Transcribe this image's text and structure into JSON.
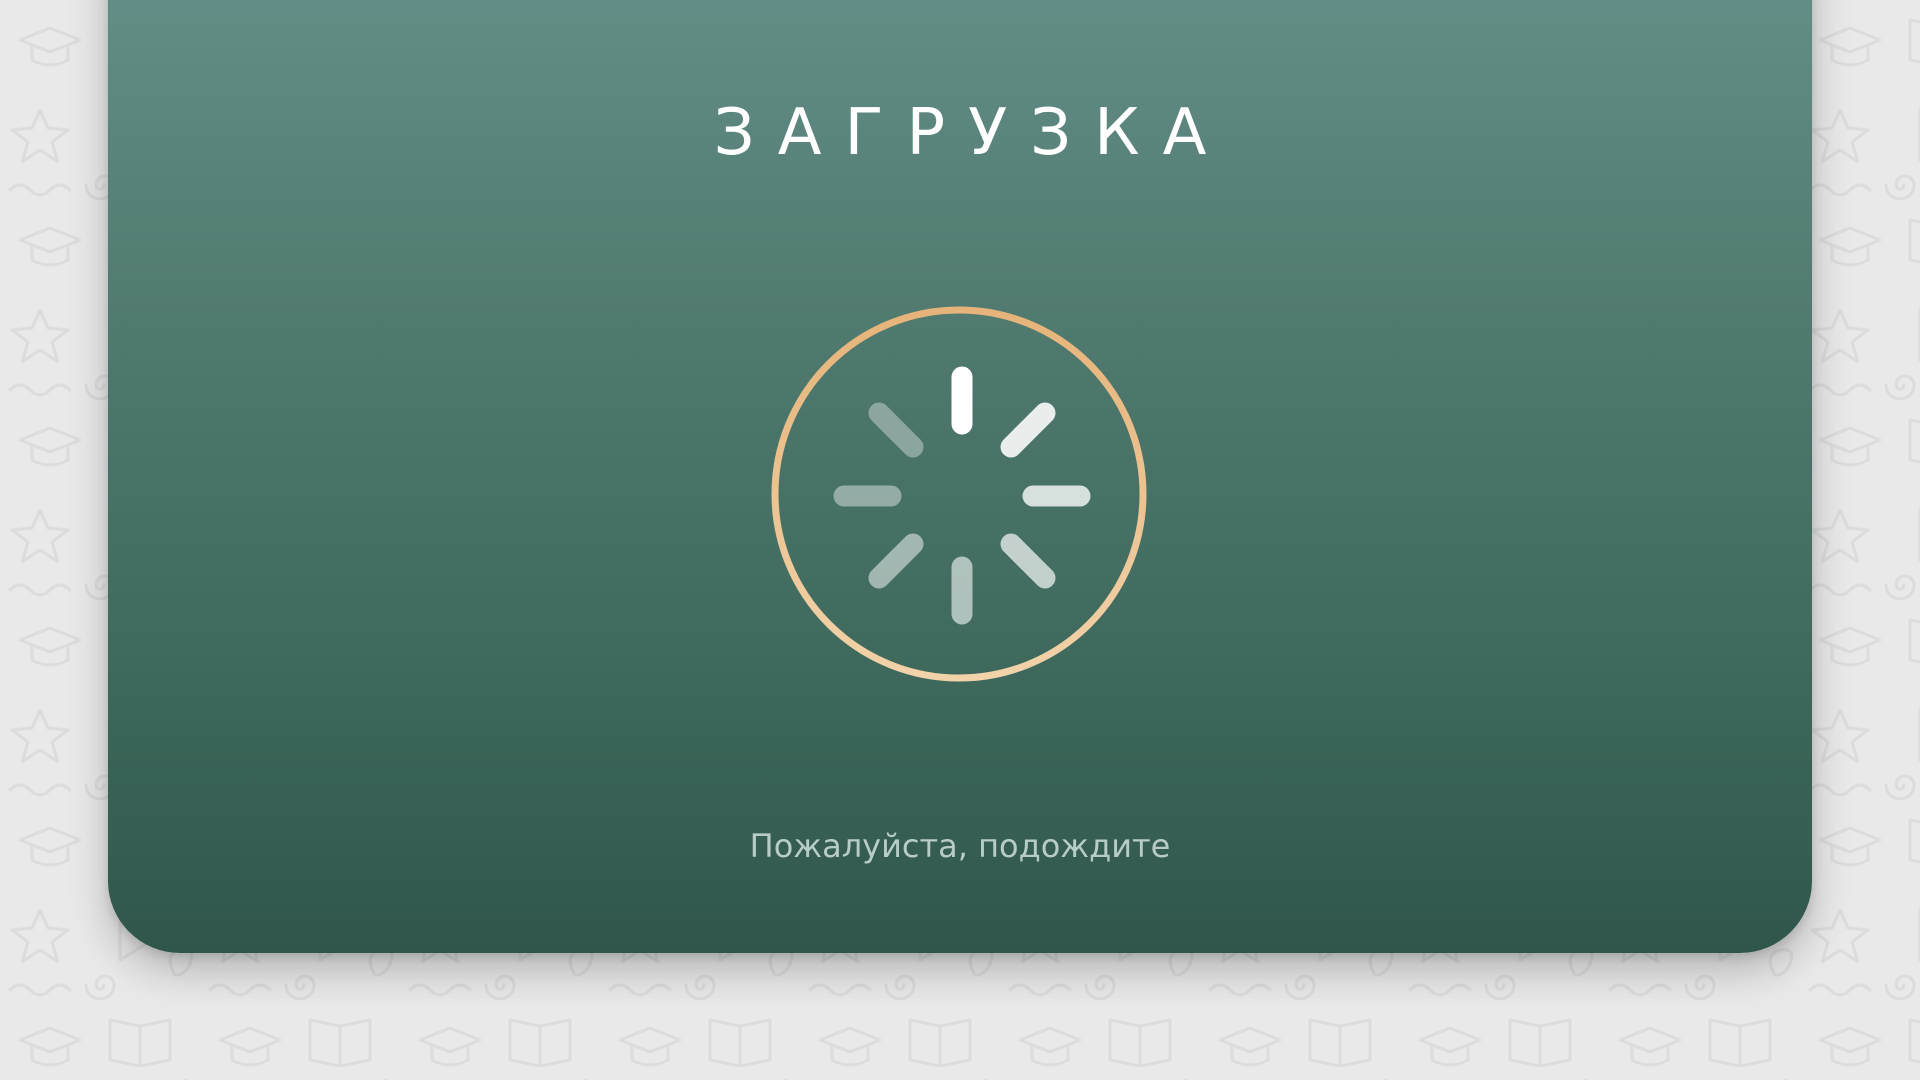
{
  "loading_screen": {
    "title": "ЗАГРУЗКА",
    "subtitle": "Пожалуйста, подождите",
    "spinner_icon": "loading-spinner-icon",
    "background_pattern": "education-doodle-pattern"
  },
  "colors": {
    "page_background": "#e9e9e9",
    "card_top": "#65918a",
    "card_bottom": "#30564b",
    "ring_gold": "#e6b47a",
    "ring_light": "#f2d2a9",
    "title_text": "#ffffff",
    "subtitle_text": "#b8ccc7",
    "spinner_ticks": "#ffffff"
  }
}
